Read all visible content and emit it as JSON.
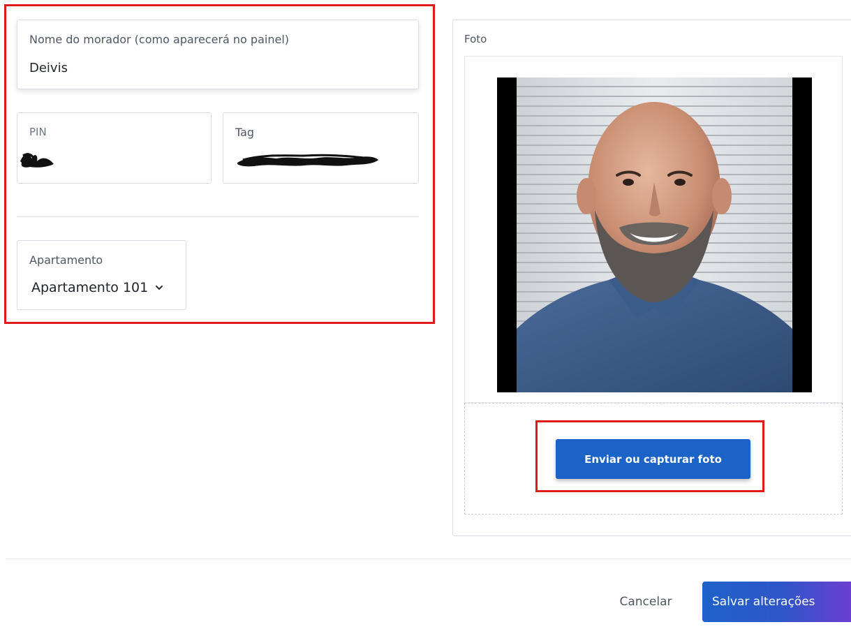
{
  "form": {
    "name_label": "Nome do morador (como aparecerá no painel)",
    "name_value": "Deivis",
    "pin_label": "PIN",
    "tag_label": "Tag",
    "apartment_label": "Apartamento",
    "apartment_value": "Apartamento 101"
  },
  "photo": {
    "label": "Foto",
    "upload_button": "Enviar ou capturar foto"
  },
  "footer": {
    "cancel_label": "Cancelar",
    "save_label": "Salvar alterações"
  },
  "colors": {
    "primary": "#1c63c7",
    "annotation_red": "#e01b1b",
    "save_gradient_end": "#6b3fd2"
  },
  "icons": {
    "apartment_select": "chevron-down-icon"
  }
}
